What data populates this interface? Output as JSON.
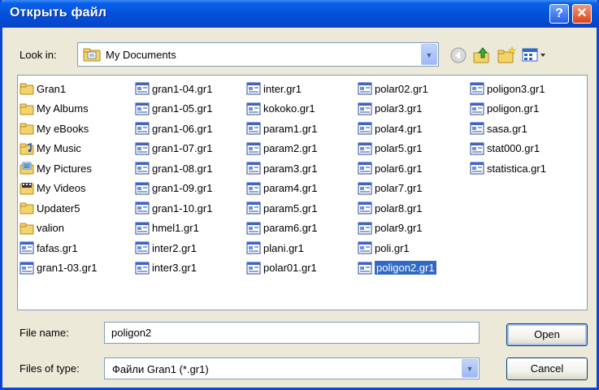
{
  "window": {
    "title": "Открыть файл"
  },
  "title_buttons": {
    "help": "?",
    "close": "✕"
  },
  "look_in": {
    "label": "Look in:",
    "value": "My Documents"
  },
  "toolbar": [
    "back-icon",
    "up-folder-icon",
    "new-folder-icon",
    "views-menu-icon"
  ],
  "files": {
    "columns": [
      [
        {
          "name": "Gran1",
          "kind": "folder"
        },
        {
          "name": "My Albums",
          "kind": "folder"
        },
        {
          "name": "My eBooks",
          "kind": "folder"
        },
        {
          "name": "My Music",
          "kind": "music-folder"
        },
        {
          "name": "My Pictures",
          "kind": "pictures-folder"
        },
        {
          "name": "My Videos",
          "kind": "videos-folder"
        },
        {
          "name": "Updater5",
          "kind": "folder"
        },
        {
          "name": "valion",
          "kind": "folder"
        },
        {
          "name": "fafas.gr1",
          "kind": "file"
        },
        {
          "name": "gran1-03.gr1",
          "kind": "file"
        }
      ],
      [
        {
          "name": "gran1-04.gr1",
          "kind": "file"
        },
        {
          "name": "gran1-05.gr1",
          "kind": "file"
        },
        {
          "name": "gran1-06.gr1",
          "kind": "file"
        },
        {
          "name": "gran1-07.gr1",
          "kind": "file"
        },
        {
          "name": "gran1-08.gr1",
          "kind": "file"
        },
        {
          "name": "gran1-09.gr1",
          "kind": "file"
        },
        {
          "name": "gran1-10.gr1",
          "kind": "file"
        },
        {
          "name": "hmel1.gr1",
          "kind": "file"
        },
        {
          "name": "inter2.gr1",
          "kind": "file"
        },
        {
          "name": "inter3.gr1",
          "kind": "file"
        }
      ],
      [
        {
          "name": "inter.gr1",
          "kind": "file"
        },
        {
          "name": "kokoko.gr1",
          "kind": "file"
        },
        {
          "name": "param1.gr1",
          "kind": "file"
        },
        {
          "name": "param2.gr1",
          "kind": "file"
        },
        {
          "name": "param3.gr1",
          "kind": "file"
        },
        {
          "name": "param4.gr1",
          "kind": "file"
        },
        {
          "name": "param5.gr1",
          "kind": "file"
        },
        {
          "name": "param6.gr1",
          "kind": "file"
        },
        {
          "name": "plani.gr1",
          "kind": "file"
        },
        {
          "name": "polar01.gr1",
          "kind": "file"
        }
      ],
      [
        {
          "name": "polar02.gr1",
          "kind": "file"
        },
        {
          "name": "polar3.gr1",
          "kind": "file"
        },
        {
          "name": "polar4.gr1",
          "kind": "file"
        },
        {
          "name": "polar5.gr1",
          "kind": "file"
        },
        {
          "name": "polar6.gr1",
          "kind": "file"
        },
        {
          "name": "polar7.gr1",
          "kind": "file"
        },
        {
          "name": "polar8.gr1",
          "kind": "file"
        },
        {
          "name": "polar9.gr1",
          "kind": "file"
        },
        {
          "name": "poli.gr1",
          "kind": "file"
        },
        {
          "name": "poligon2.gr1",
          "kind": "file",
          "selected": true
        }
      ],
      [
        {
          "name": "poligon3.gr1",
          "kind": "file"
        },
        {
          "name": "poligon.gr1",
          "kind": "file"
        },
        {
          "name": "sasa.gr1",
          "kind": "file"
        },
        {
          "name": "stat000.gr1",
          "kind": "file"
        },
        {
          "name": "statistica.gr1",
          "kind": "file"
        }
      ]
    ]
  },
  "file_name": {
    "label": "File name:",
    "value": "poligon2"
  },
  "file_type": {
    "label": "Files of type:",
    "value": "Файли Gran1 (*.gr1)"
  },
  "buttons": {
    "open": "Open",
    "cancel": "Cancel"
  },
  "colors": {
    "selection": "#316ac5",
    "title_bar": "#0452dc",
    "dialog_bg": "#ece9d8"
  }
}
